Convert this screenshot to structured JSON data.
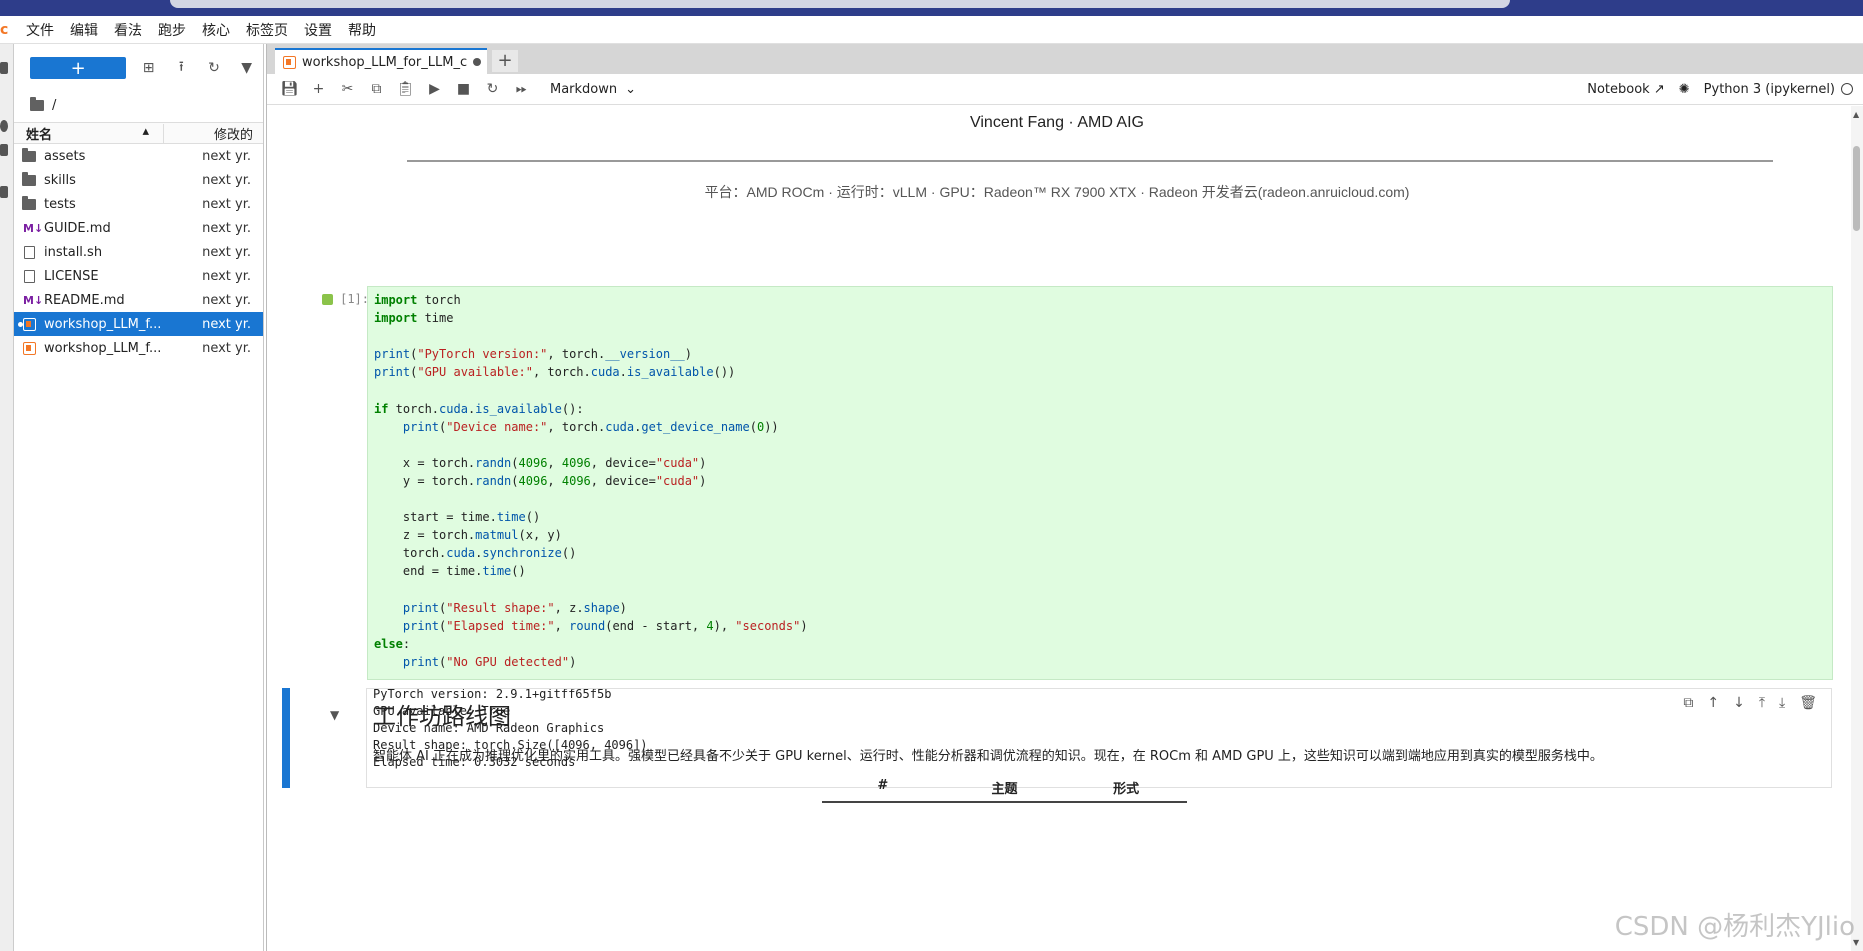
{
  "menubar": {
    "items": [
      "文件",
      "编辑",
      "看法",
      "跑步",
      "核心",
      "标签页",
      "设置",
      "帮助"
    ]
  },
  "filebrowser": {
    "new_label": "+",
    "path": "/",
    "header": {
      "name": "姓名",
      "modified": "修改的"
    },
    "rows": [
      {
        "name": "assets",
        "date": "next yr.",
        "type": "folder"
      },
      {
        "name": "skills",
        "date": "next yr.",
        "type": "folder"
      },
      {
        "name": "tests",
        "date": "next yr.",
        "type": "folder"
      },
      {
        "name": "GUIDE.md",
        "date": "next yr.",
        "type": "md"
      },
      {
        "name": "install.sh",
        "date": "next yr.",
        "type": "file"
      },
      {
        "name": "LICENSE",
        "date": "next yr.",
        "type": "file"
      },
      {
        "name": "README.md",
        "date": "next yr.",
        "type": "md"
      },
      {
        "name": "workshop_LLM_f...",
        "date": "next yr.",
        "type": "notebook",
        "selected": true
      },
      {
        "name": "workshop_LLM_f...",
        "date": "next yr.",
        "type": "notebook"
      }
    ]
  },
  "tab": {
    "label": "workshop_LLM_for_LLM_cn.i"
  },
  "toolbar": {
    "cell_type": "Markdown",
    "notebook_label": "Notebook",
    "kernel": "Python 3 (ipykernel)"
  },
  "notebook": {
    "author": "Vincent Fang · AMD AIG",
    "platform": "平台：AMD ROCm  ·  运行时：vLLM  ·  GPU：Radeon™ RX 7900 XTX · Radeon 开发者云(radeon.anruicloud.com)",
    "prompt": "[1]:",
    "output_lines": [
      "PyTorch version: 2.9.1+gitff65f5b",
      "GPU available: True",
      "Device name: AMD Radeon Graphics",
      "Result shape: torch.Size([4096, 4096])",
      "Elapsed time: 0.3032 seconds"
    ],
    "md_heading": "工作坊路线图",
    "md_paragraph": "智能体 AI 正在成为推理优化里的实用工具。强模型已经具备不少关于 GPU kernel、运行时、性能分析器和调优流程的知识。现在，在 ROCm 和 AMD GPU 上，这些知识可以端到端地应用到真实的模型服务栈中。",
    "md_table_headers": [
      "#",
      "主题",
      "形式"
    ]
  },
  "watermark": "CSDN @杨利杰YJlio"
}
